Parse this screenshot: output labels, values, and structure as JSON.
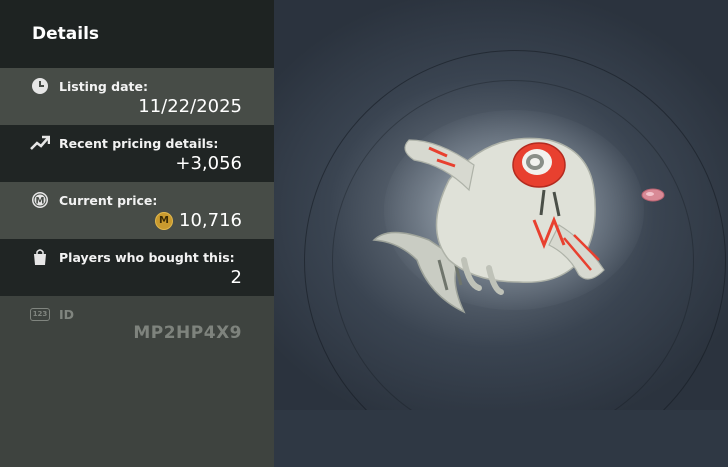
{
  "panel": {
    "title": "Details",
    "rows": [
      {
        "label": "Listing date:",
        "value": "11/22/2025",
        "icon": "clock-icon"
      },
      {
        "label": "Recent pricing details:",
        "value": "+3,056",
        "icon": "trend-up-icon"
      },
      {
        "label": "Current price:",
        "value": "10,716",
        "icon": "currency-icon",
        "currency_symbol": "M"
      },
      {
        "label": "Players who bought this:",
        "value": "2",
        "icon": "shopping-bag-icon"
      },
      {
        "label": "ID",
        "value": "MP2HP4X9",
        "icon": "id-badge-icon",
        "badge_text": "123"
      }
    ]
  },
  "colors": {
    "panel_dark": "#202524",
    "panel_light": "#474c47",
    "coin_gold": "#c99a2e",
    "creature_accent": "#e8402f"
  }
}
